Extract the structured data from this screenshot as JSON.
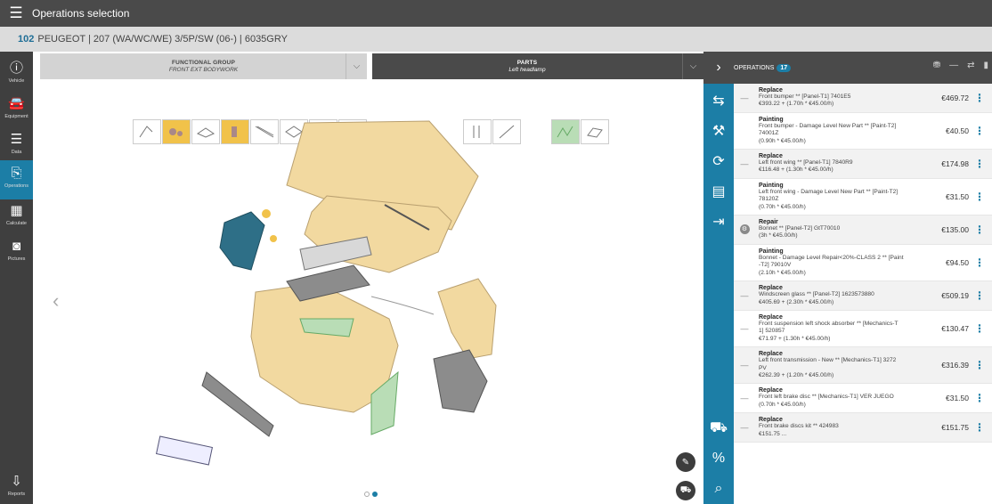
{
  "app": {
    "title": "Operations selection",
    "menu_icon": "hamburger-icon"
  },
  "vehicle": {
    "code": "102",
    "description": "PEUGEOT | 207 (WA/WC/WE) 3/5P/SW (06-) | 6035GRY"
  },
  "left_nav": [
    {
      "icon": "info-icon",
      "label": "Vehicle"
    },
    {
      "icon": "car-icon",
      "label": "Equipment"
    },
    {
      "icon": "list-icon",
      "label": "Data"
    },
    {
      "icon": "operations-icon",
      "label": "Operations",
      "active": true
    },
    {
      "icon": "calculator-icon",
      "label": "Calculate"
    },
    {
      "icon": "camera-icon",
      "label": "Pictures"
    },
    {
      "icon": "download-icon",
      "label": "Reports"
    }
  ],
  "tabs": {
    "functional_group": {
      "title": "FUNCTIONAL GROUP",
      "value": "FRONT EXT BODYWORK"
    },
    "parts": {
      "title": "PARTS",
      "value": "Left headlamp"
    }
  },
  "pager": {
    "pages": 2,
    "current": 2
  },
  "operations": {
    "label": "OPERATIONS",
    "count": "17",
    "items": [
      {
        "type": "Replace",
        "lines": [
          "Front bumper ** [Panel-T1] 7401E5",
          "€393.22 + (1.70h * €45.00/h)"
        ],
        "price": "€469.72",
        "marker": "—"
      },
      {
        "type": "Painting",
        "lines": [
          "Front bumper - Damage Level New Part ** [Paint-T2]",
          "74001Z",
          "(0.90h * €45.00/h)"
        ],
        "price": "€40.50",
        "marker": ""
      },
      {
        "type": "Replace",
        "lines": [
          "Left front wing ** [Panel-T1] 7840R9",
          "€116.48 + (1.30h * €45.00/h)"
        ],
        "price": "€174.98",
        "marker": "—"
      },
      {
        "type": "Painting",
        "lines": [
          "Left front wing - Damage Level New Part ** [Paint-T2]",
          "78120Z",
          "(0.70h * €45.00/h)"
        ],
        "price": "€31.50",
        "marker": ""
      },
      {
        "type": "Repair",
        "lines": [
          "Bonnet ** [Panel-T2] GtT70010",
          "(3h * €45.00/h)"
        ],
        "price": "€135.00",
        "marker": "repair"
      },
      {
        "type": "Painting",
        "lines": [
          "Bonnet - Damage Level Repair<20%-CLASS 2 ** [Paint",
          "-T2] 79010V",
          "(2.10h * €45.00/h)"
        ],
        "price": "€94.50",
        "marker": ""
      },
      {
        "type": "Replace",
        "lines": [
          "Windscreen glass ** [Panel-T2] 1623573880",
          "€405.69 + (2.30h * €45.00/h)"
        ],
        "price": "€509.19",
        "marker": "—"
      },
      {
        "type": "Replace",
        "lines": [
          "Front suspension left shock absorber ** [Mechanics-T",
          "1] 520857",
          "€71.97 + (1.30h * €45.00/h)"
        ],
        "price": "€130.47",
        "marker": "—"
      },
      {
        "type": "Replace",
        "lines": [
          "Left front transmission - New ** [Mechanics-T1] 3272",
          "PV",
          "€262.39 + (1.20h * €45.00/h)"
        ],
        "price": "€316.39",
        "marker": "—"
      },
      {
        "type": "Replace",
        "lines": [
          "Front left brake disc ** [Mechanics-T1] VER JUEGO",
          "(0.70h * €45.00/h)"
        ],
        "price": "€31.50",
        "marker": "—"
      },
      {
        "type": "Replace",
        "lines": [
          "Front brake discs kit ** 424983",
          "€151.75 ..."
        ],
        "price": "€151.75",
        "marker": "—"
      }
    ]
  },
  "colors": {
    "accent": "#1c7ea6",
    "topbar": "#4a4a4a",
    "selected_part": "#f1c24a",
    "dark_part": "#2e6f87"
  }
}
